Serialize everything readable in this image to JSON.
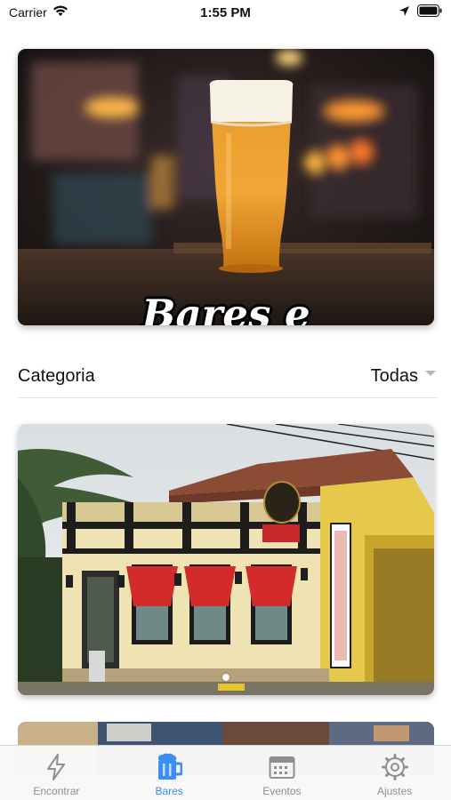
{
  "status_bar": {
    "carrier": "Carrier",
    "time": "1:55 PM"
  },
  "hero": {
    "title": "Bares e Restaurantes"
  },
  "filter": {
    "label": "Categoria",
    "selected": "Todas"
  },
  "tab_bar": {
    "accent_color": "#3a8ef6",
    "inactive_color": "#8e8e93",
    "tabs": [
      {
        "label": "Encontrar",
        "icon": "lightning-icon",
        "active": false
      },
      {
        "label": "Bares",
        "icon": "beer-mug-icon",
        "active": true
      },
      {
        "label": "Eventos",
        "icon": "calendar-icon",
        "active": false
      },
      {
        "label": "Ajustes",
        "icon": "gear-icon",
        "active": false
      }
    ]
  }
}
